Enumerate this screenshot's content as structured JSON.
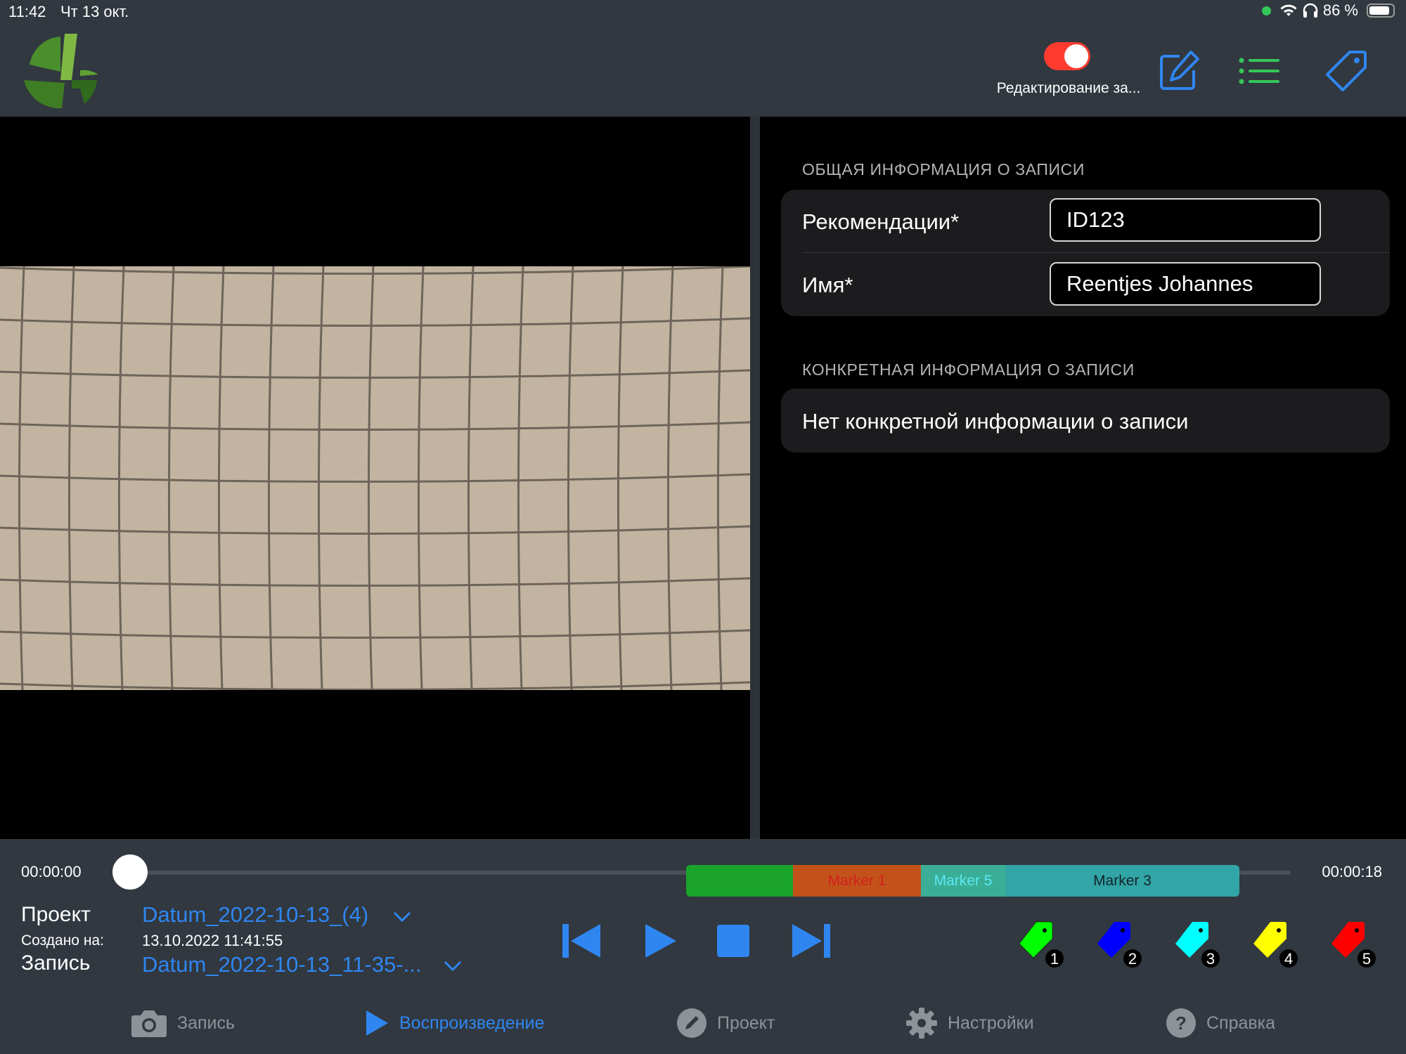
{
  "status": {
    "time": "11:42",
    "date": "Чт 13 окт.",
    "battery": "86 %",
    "battery_level": 0.86
  },
  "header": {
    "toggle_label": "Редактирование за...",
    "toggle_on": true
  },
  "info": {
    "section1_title": "ОБЩАЯ ИНФОРМАЦИЯ О ЗАПИСИ",
    "recommend_label": "Рекомендации*",
    "recommend_value": "ID123",
    "name_label": "Имя*",
    "name_value": "Reentjes Johannes",
    "section2_title": "КОНКРЕТНАЯ ИНФОРМАЦИЯ О ЗАПИСИ",
    "no_info": "Нет конкретной информации о записи"
  },
  "player": {
    "time_start": "00:00:00",
    "time_end": "00:00:18",
    "markers": [
      {
        "label": "",
        "color": "#1aa42a",
        "text_color": "#ffffff"
      },
      {
        "label": "Marker 1",
        "color": "#c2521a",
        "text_color": "#d21f1f"
      },
      {
        "label": "Marker 5",
        "color": "#3aae96",
        "text_color": "#5be8f2"
      },
      {
        "label": "Marker 3",
        "color": "#32a5a6",
        "text_color": "#12242a"
      }
    ]
  },
  "details": {
    "project_label": "Проект",
    "created_label": "Создано на:",
    "record_label": "Запись",
    "project_value": "Datum_2022-10-13_(4)",
    "created_value": "13.10.2022 11:41:55",
    "record_value": "Datum_2022-10-13_11-35-..."
  },
  "marker_buttons": [
    {
      "number": "1",
      "color": "#00ff00"
    },
    {
      "number": "2",
      "color": "#0000ff"
    },
    {
      "number": "3",
      "color": "#00ffff"
    },
    {
      "number": "4",
      "color": "#ffff00"
    },
    {
      "number": "5",
      "color": "#ff0000"
    }
  ],
  "tabs": {
    "record": "Запись",
    "playback": "Воспроизведение",
    "project": "Проект",
    "settings": "Настройки",
    "help": "Справка"
  },
  "colors": {
    "accent": "#2f86f0",
    "green": "#34c759",
    "toggle": "#ff3b30",
    "bar": "#313840"
  }
}
